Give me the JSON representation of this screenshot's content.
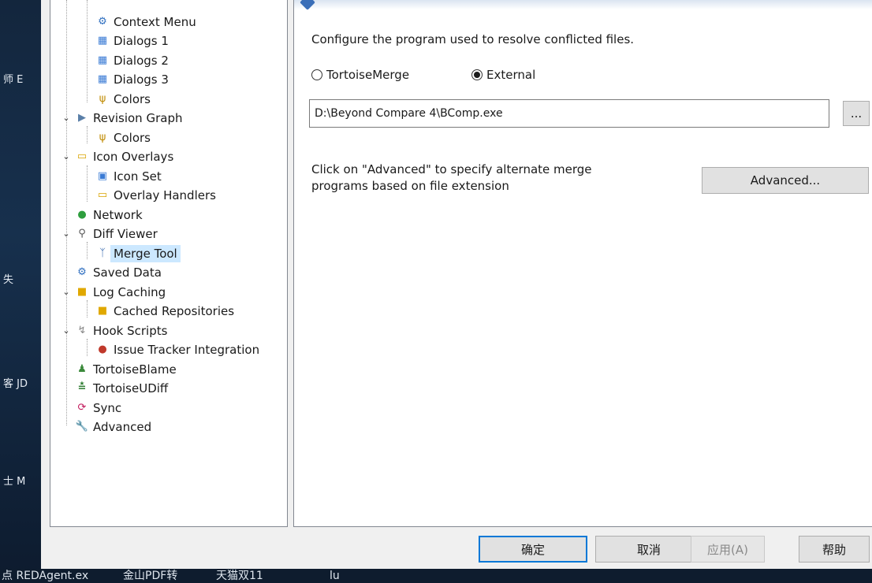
{
  "desktop": {
    "labels": [
      "师 E",
      "失",
      "客 JD",
      "士 M"
    ]
  },
  "taskbar": {
    "items": [
      "点 REDAgent.ex",
      "金山PDF转",
      "天猫双11",
      "lu"
    ]
  },
  "tree": {
    "items": [
      {
        "label": "Context Menu",
        "icon": "gear-icon"
      },
      {
        "label": "Dialogs 1",
        "icon": "dialog-icon"
      },
      {
        "label": "Dialogs 2",
        "icon": "dialog-icon"
      },
      {
        "label": "Dialogs 3",
        "icon": "dialog-icon"
      },
      {
        "label": "Colors",
        "icon": "palette-icon"
      },
      {
        "label": "Revision Graph",
        "icon": "revision-graph-icon"
      },
      {
        "label": "Colors",
        "icon": "palette-icon"
      },
      {
        "label": "Icon Overlays",
        "icon": "overlay-folder-icon"
      },
      {
        "label": "Icon Set",
        "icon": "icon-set-icon"
      },
      {
        "label": "Overlay Handlers",
        "icon": "overlay-folder-icon"
      },
      {
        "label": "Network",
        "icon": "globe-icon"
      },
      {
        "label": "Diff Viewer",
        "icon": "magnifier-icon"
      },
      {
        "label": "Merge Tool",
        "icon": "merge-icon"
      },
      {
        "label": "Saved Data",
        "icon": "gear-icon"
      },
      {
        "label": "Log Caching",
        "icon": "database-icon"
      },
      {
        "label": "Cached Repositories",
        "icon": "database-icon"
      },
      {
        "label": "Hook Scripts",
        "icon": "hook-icon"
      },
      {
        "label": "Issue Tracker Integration",
        "icon": "bug-icon"
      },
      {
        "label": "TortoiseBlame",
        "icon": "blame-icon"
      },
      {
        "label": "TortoiseUDiff",
        "icon": "udiff-icon"
      },
      {
        "label": "Sync",
        "icon": "sync-icon"
      },
      {
        "label": "Advanced",
        "icon": "wrench-icon"
      }
    ]
  },
  "panel": {
    "description": "Configure the program used to resolve conflicted files.",
    "radio_tortoisemerge": "TortoiseMerge",
    "radio_external": "External",
    "selected": "External",
    "path_value": "D:\\Beyond Compare 4\\BComp.exe",
    "browse_label": "...",
    "advanced_text_line1": "Click on \"Advanced\" to specify alternate merge",
    "advanced_text_line2": "programs based on file extension",
    "advanced_button": "Advanced..."
  },
  "footer": {
    "ok": "确定",
    "cancel": "取消",
    "apply": "应用(A)",
    "help": "帮助"
  }
}
